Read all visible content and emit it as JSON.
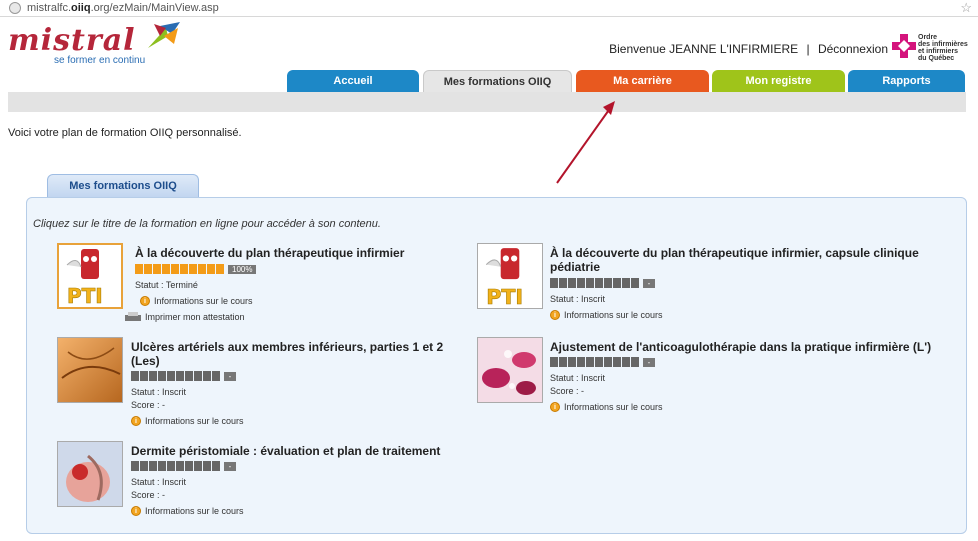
{
  "address": {
    "host_prefix": "mistralfc.",
    "host_bold": "oiiq",
    "host_suffix": ".org/ezMain/MainView.asp"
  },
  "header": {
    "logo_word": "mistral",
    "logo_tagline": "se former en continu",
    "welcome": "Bienvenue JEANNE L'INFIRMIERE",
    "separator": "|",
    "logout": "Déconnexion",
    "org_lines": [
      "Ordre",
      "des infirmières",
      "et infirmiers",
      "du Québec"
    ]
  },
  "nav": {
    "tabs": [
      "Accueil",
      "Mes formations OIIQ",
      "Ma carrière",
      "Mon registre",
      "Rapports"
    ]
  },
  "intro": "Voici votre plan de formation OIIQ personnalisé.",
  "panel": {
    "tab_label": "Mes formations OIIQ",
    "hint": "Cliquez sur le titre de la formation en ligne pour accéder à son contenu."
  },
  "courses": [
    {
      "title": "À la découverte du plan thérapeutique infirmier",
      "progress_label": "100%",
      "progress": 1.0,
      "status": "Statut : Terminé",
      "info": "Informations sur le cours",
      "print": "Imprimer mon attestation"
    },
    {
      "title": "À la découverte du plan thérapeutique infirmier, capsule clinique pédiatrie",
      "progress_label": "-",
      "progress": 0,
      "status": "Statut : Inscrit",
      "info": "Informations sur le cours"
    },
    {
      "title": "Ulcères artériels aux membres inférieurs, parties 1 et 2 (Les)",
      "progress_label": "-",
      "progress": 0,
      "status": "Statut : Inscrit",
      "score": "Score : -",
      "info": "Informations sur le cours"
    },
    {
      "title": "Ajustement de l'anticoagulothérapie dans la pratique infirmière (L')",
      "progress_label": "-",
      "progress": 0,
      "status": "Statut : Inscrit",
      "score": "Score : -",
      "info": "Informations sur le cours"
    },
    {
      "title": "Dermite péristomiale : évaluation et plan de traitement",
      "progress_label": "-",
      "progress": 0,
      "status": "Statut : Inscrit",
      "score": "Score : -",
      "info": "Informations sur le cours"
    }
  ],
  "thumb_labels": {
    "pti": "PTI"
  },
  "colors": {
    "accueil": "#1d88c7",
    "carriere": "#e8591f",
    "registre": "#9fc41a",
    "rapports": "#1d88c7",
    "progress_done": "#f39b17"
  }
}
